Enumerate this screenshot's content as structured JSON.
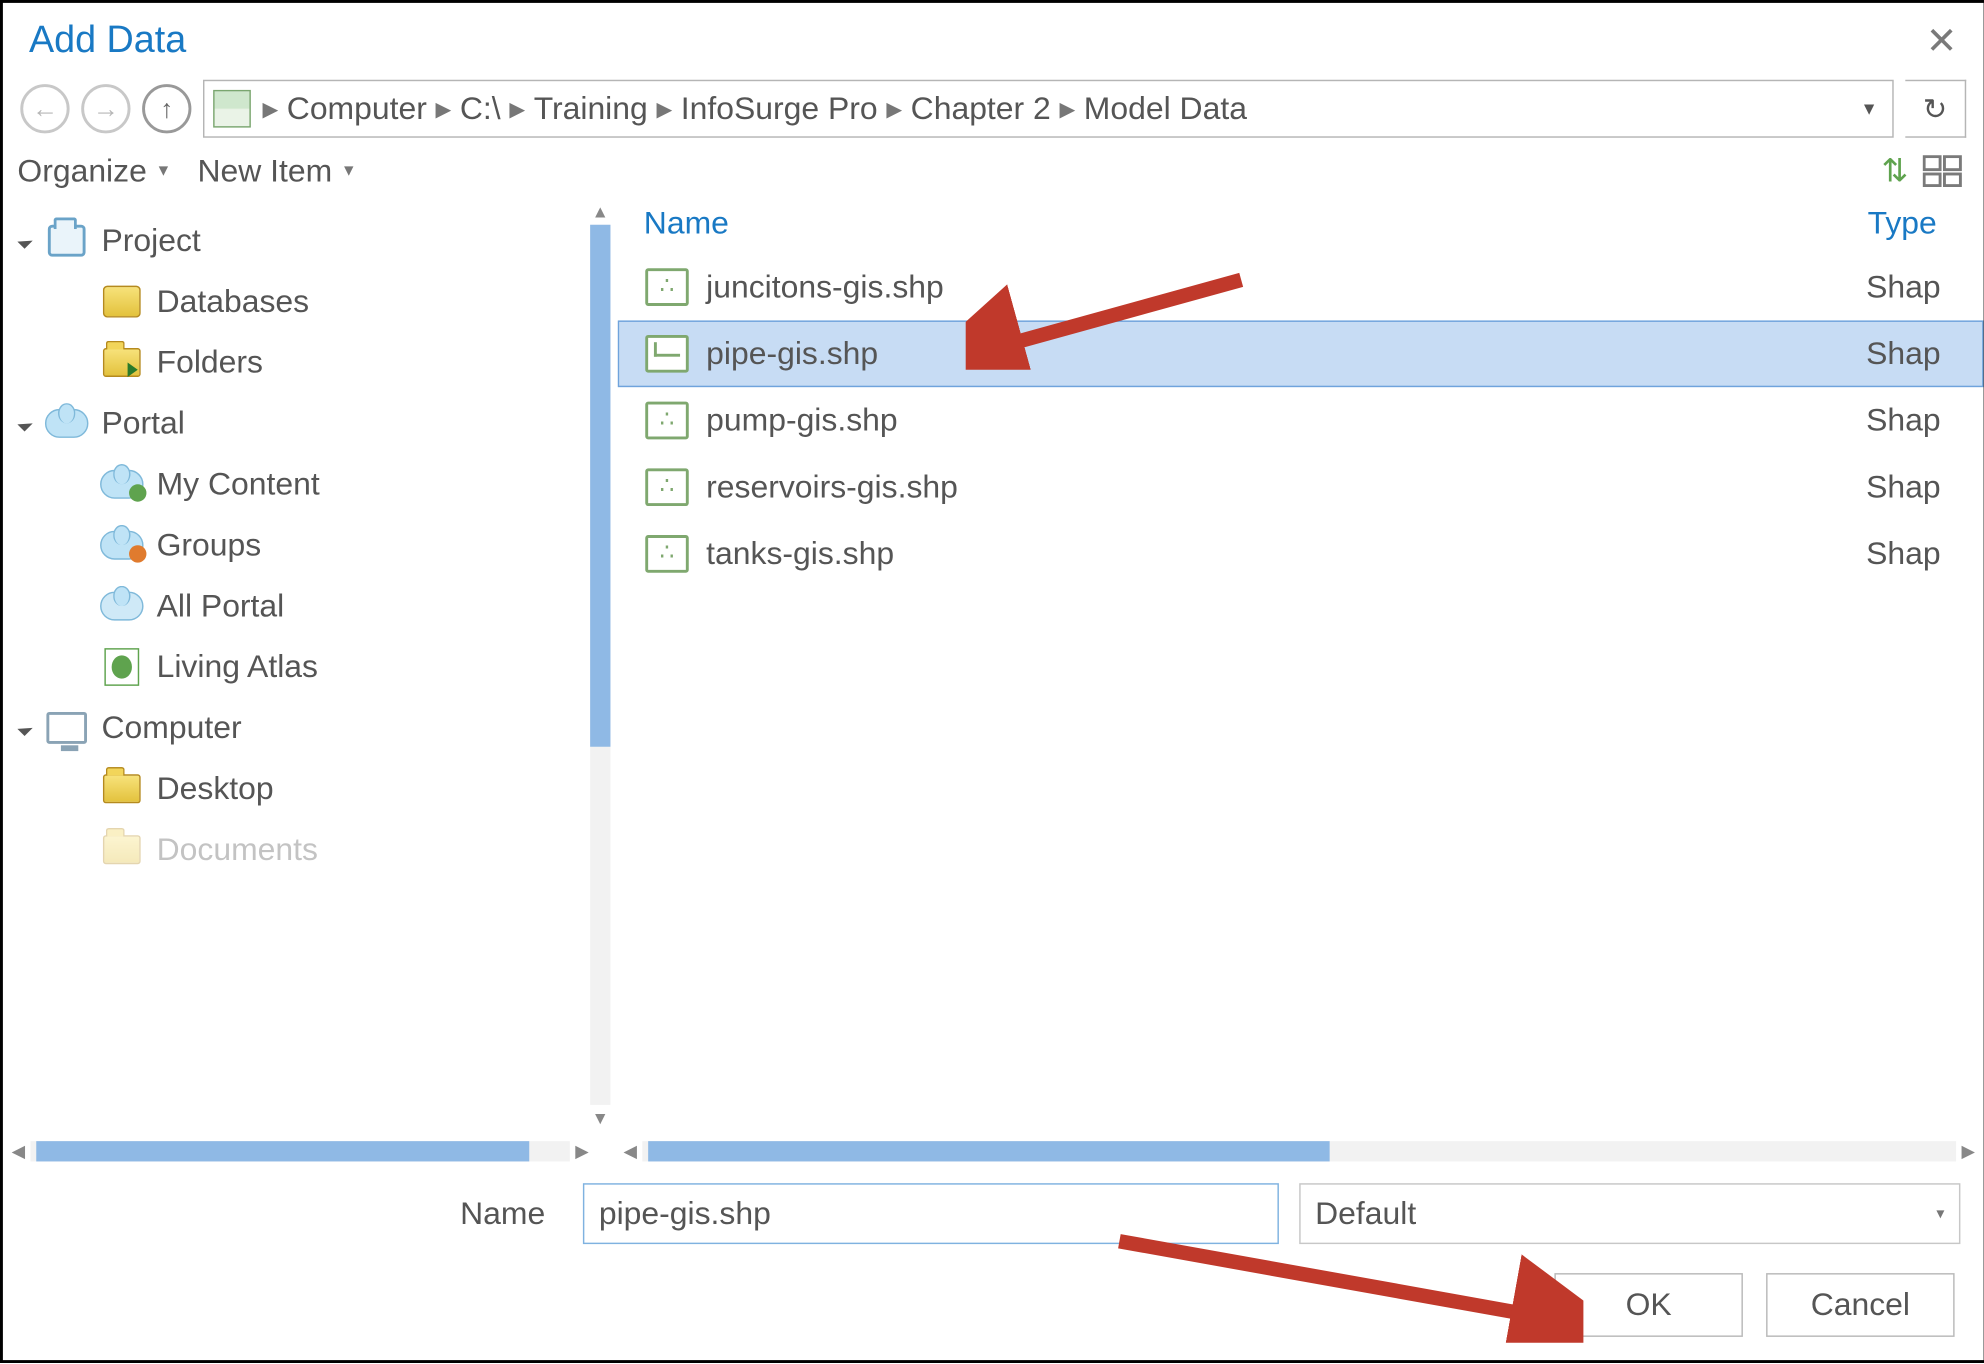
{
  "title": "Add Data",
  "breadcrumb": [
    "Computer",
    "C:\\",
    "Training",
    "InfoSurge Pro",
    "Chapter 2",
    "Model Data"
  ],
  "toolbar": {
    "organize": "Organize",
    "newitem": "New Item"
  },
  "tree": {
    "n0": "Project",
    "n0a": "Databases",
    "n0b": "Folders",
    "n1": "Portal",
    "n1a": "My Content",
    "n1b": "Groups",
    "n1c": "All Portal",
    "n1d": "Living Atlas",
    "n2": "Computer",
    "n2a": "Desktop",
    "n2b": "Documents"
  },
  "columns": {
    "name": "Name",
    "type": "Type"
  },
  "files": [
    {
      "name": "juncitons-gis.shp",
      "type": "Shap",
      "icon": "points",
      "selected": false
    },
    {
      "name": "pipe-gis.shp",
      "type": "Shap",
      "icon": "line",
      "selected": true
    },
    {
      "name": "pump-gis.shp",
      "type": "Shap",
      "icon": "points",
      "selected": false
    },
    {
      "name": "reservoirs-gis.shp",
      "type": "Shap",
      "icon": "points",
      "selected": false
    },
    {
      "name": "tanks-gis.shp",
      "type": "Shap",
      "icon": "points",
      "selected": false
    }
  ],
  "name_label": "Name",
  "name_value": "pipe-gis.shp",
  "filter_value": "Default",
  "ok": "OK",
  "cancel": "Cancel"
}
